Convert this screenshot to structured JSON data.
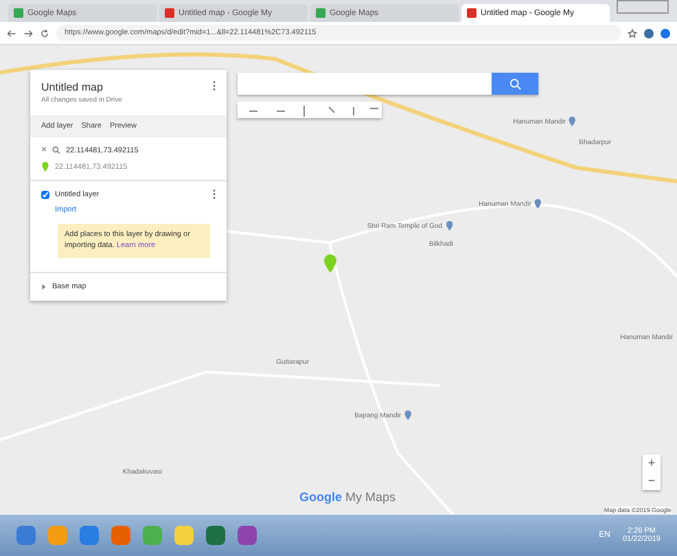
{
  "tabs": [
    {
      "title": "Google Maps",
      "kind": "maps",
      "selected": false
    },
    {
      "title": "Untitled map - Google My",
      "kind": "mymaps",
      "selected": false
    },
    {
      "title": "Google Maps",
      "kind": "maps",
      "selected": false
    },
    {
      "title": "Untitled map - Google My",
      "kind": "mymaps",
      "selected": true
    }
  ],
  "address_bar": {
    "url": "https://www.google.com/maps/d/edit?mid=1...&ll=22.114481%2C73.492115"
  },
  "panel": {
    "title": "Untitled map",
    "subtitle": "All changes saved in Drive",
    "actions": [
      "Add layer",
      "Share",
      "Preview"
    ],
    "search_layer": {
      "close": "×",
      "query": "22.114481,73.492115",
      "result": "22.114481,73.492115"
    },
    "layer": {
      "title": "Untitled layer",
      "checked": true,
      "import": "Import",
      "hint": "Add places to this layer by drawing or importing data.",
      "hint_link": "Learn more"
    },
    "base_map": {
      "label": "Base map"
    }
  },
  "map": {
    "labels": [
      {
        "text": "Hanuman Mandir",
        "pin": true
      },
      {
        "text": "Bhadarpur",
        "pin": false
      },
      {
        "text": "Hanuman Mandir",
        "pin": true
      },
      {
        "text": "Shri Ram Temple of God",
        "pin": true
      },
      {
        "text": "Bilkhadi",
        "pin": false
      },
      {
        "text": "Hanuman Mandir",
        "pin": false
      },
      {
        "text": "Guttarapur",
        "pin": false
      },
      {
        "text": "Bajrang Mandir",
        "pin": true
      },
      {
        "text": "Khadakuvasi",
        "pin": false
      }
    ],
    "logo": {
      "google": "Google",
      "suffix": "My Maps"
    },
    "zoom_in": "+",
    "zoom_out": "−",
    "attribution": "Map data ©2019 Google"
  },
  "taskbar": {
    "language": "EN",
    "time": "2:26 PM",
    "date": "01/22/2019"
  }
}
